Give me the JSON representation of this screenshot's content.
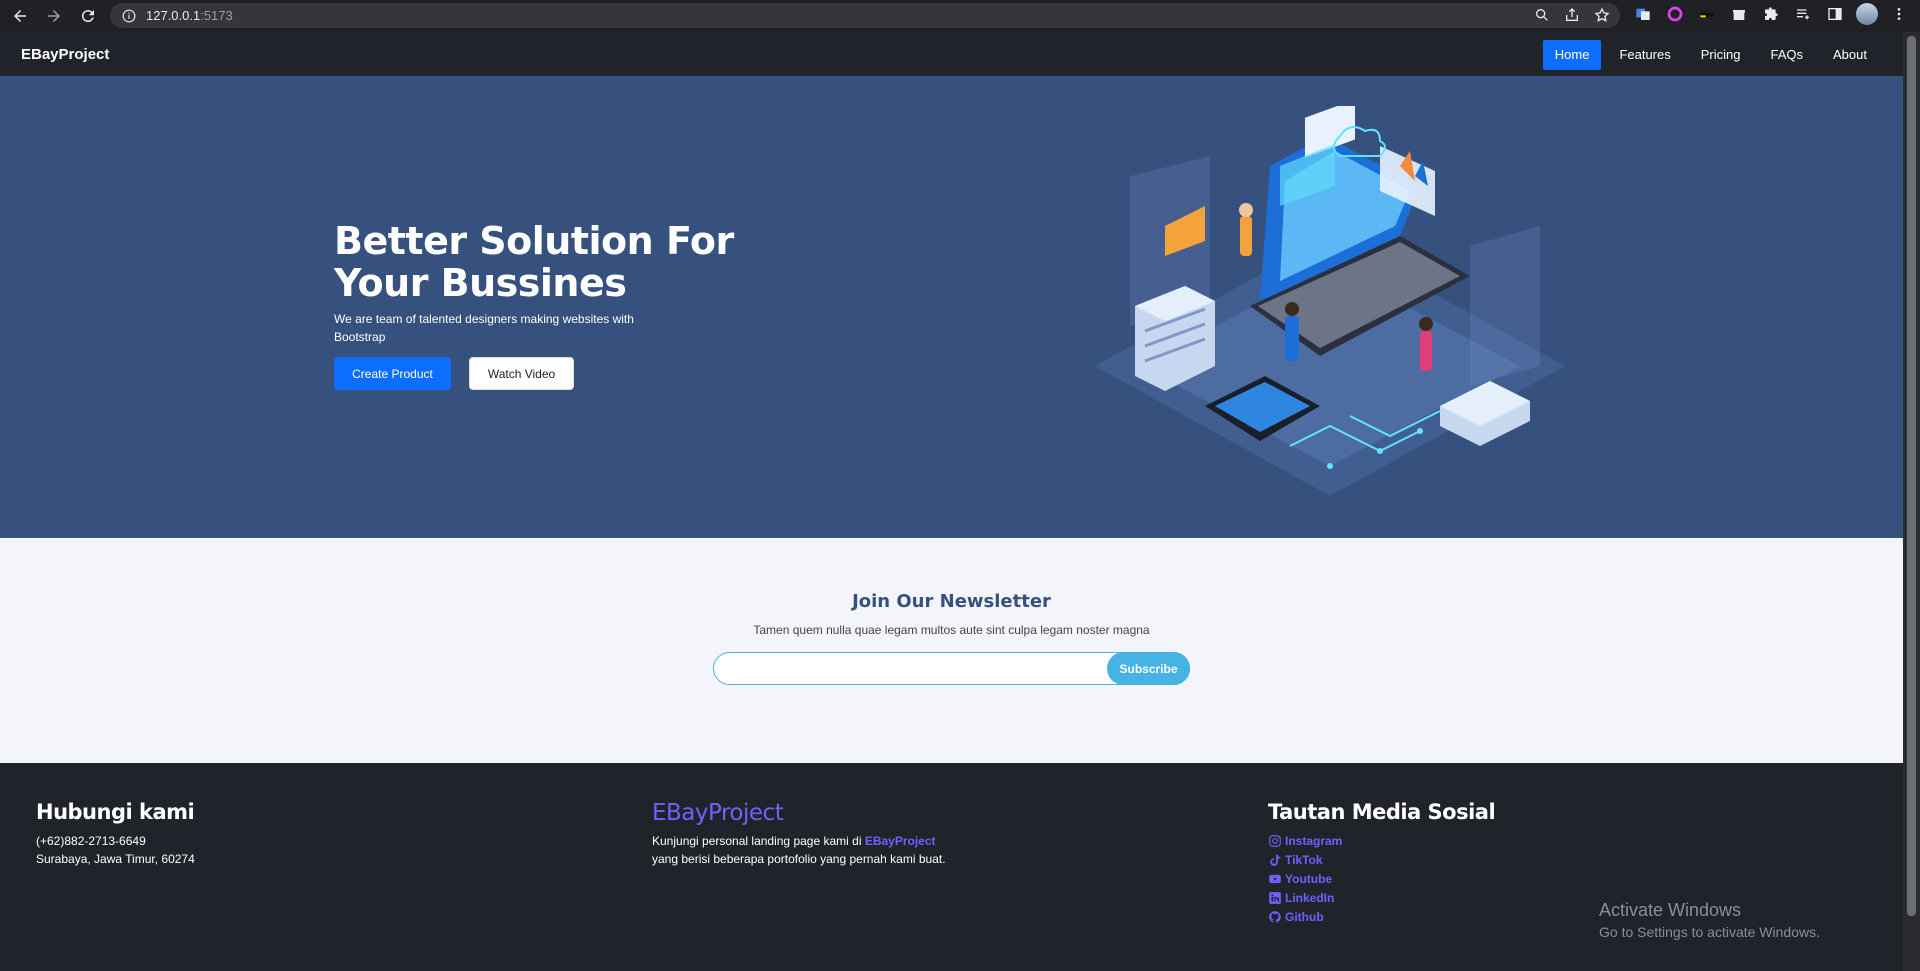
{
  "browser": {
    "url_host": "127.0.0.1",
    "url_port": ":5173"
  },
  "navbar": {
    "brand": "EBayProject",
    "links": [
      "Home",
      "Features",
      "Pricing",
      "FAQs",
      "About"
    ]
  },
  "hero": {
    "title": "Better Solution For Your Bussines",
    "subtitle": "We are team of talented designers making websites with Bootstrap",
    "primary_button": "Create Product",
    "secondary_button": "Watch Video"
  },
  "newsletter": {
    "title": "Join Our Newsletter",
    "subtitle": "Tamen quem nulla quae legam multos aute sint culpa legam noster magna",
    "input_value": "",
    "button": "Subscribe"
  },
  "footer": {
    "contact": {
      "title": "Hubungi kami",
      "phone": "(+62)882-2713-6649",
      "address": "Surabaya, Jawa Timur, 60274"
    },
    "about": {
      "title": "EBayProject",
      "text_before": "Kunjungi personal landing page kami di ",
      "link": "EBayProject",
      "text_after": "yang berisi beberapa portofolio yang pernah kami buat."
    },
    "social": {
      "title": "Tautan Media Sosial",
      "links": [
        "Instagram",
        "TikTok",
        "Youtube",
        "LinkedIn",
        "Github"
      ]
    }
  },
  "watermark": {
    "line1": "Activate Windows",
    "line2": "Go to Settings to activate Windows."
  },
  "colors": {
    "hero_bg": "#37517e",
    "primary": "#0d6efd",
    "accent": "#47b2e4",
    "footer_bg": "#20232a",
    "link": "#6c63ff"
  }
}
